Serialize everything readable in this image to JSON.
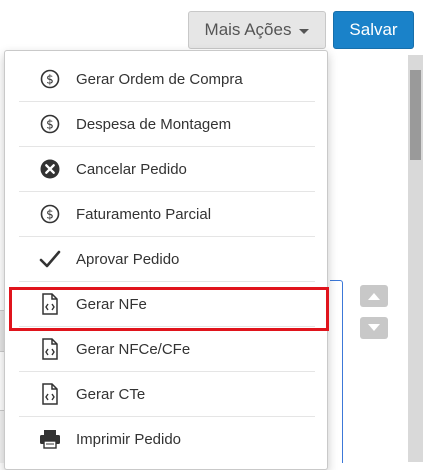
{
  "toolbar": {
    "more_actions_label": "Mais Ações",
    "save_label": "Salvar"
  },
  "menu": {
    "items": [
      {
        "label": "Gerar Ordem de Compra",
        "icon": "dollar-circle-icon"
      },
      {
        "label": "Despesa de Montagem",
        "icon": "dollar-circle-icon"
      },
      {
        "label": "Cancelar Pedido",
        "icon": "cancel-circle-icon"
      },
      {
        "label": "Faturamento Parcial",
        "icon": "dollar-circle-icon"
      },
      {
        "label": "Aprovar Pedido",
        "icon": "checkmark-icon",
        "highlighted": true
      },
      {
        "label": "Gerar NFe",
        "icon": "code-file-icon"
      },
      {
        "label": "Gerar NFCe/CFe",
        "icon": "code-file-icon"
      },
      {
        "label": "Gerar CTe",
        "icon": "code-file-icon"
      },
      {
        "label": "Imprimir Pedido",
        "icon": "printer-icon"
      }
    ]
  },
  "colors": {
    "save_button": "#1a82c9",
    "highlight_border": "#e0141c",
    "more_button_bg": "#e6e6e6"
  }
}
